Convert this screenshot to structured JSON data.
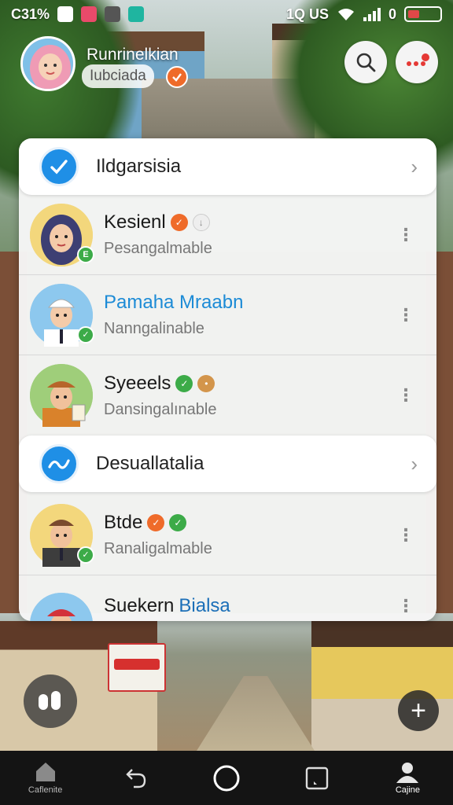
{
  "status_bar": {
    "left_text": "C31%",
    "right_text": "1Q US",
    "battery_text": "0"
  },
  "header": {
    "title": "Runrinelkian",
    "subtitle": "Iubciada"
  },
  "sections": [
    {
      "label": "Ildgarsisia"
    },
    {
      "label": "Desuallatalia"
    }
  ],
  "contacts": [
    {
      "name": "Kesienl",
      "subtitle": "Pesangalmable",
      "check_text": "E"
    },
    {
      "name": "Pamaha Mraabn",
      "subtitle": "Nanngalinable",
      "check_text": "✓"
    },
    {
      "name": "Syeeels",
      "subtitle": "Dansingalınable"
    },
    {
      "name": "Btde",
      "subtitle": "Ranaligalmable",
      "check_text": "✓"
    },
    {
      "name": "Suekern",
      "name_highlight": "Bialsa"
    }
  ],
  "bottom_nav": [
    {
      "label": "Caflenite",
      "icon": "home-icon"
    },
    {
      "label": "",
      "icon": "back-icon"
    },
    {
      "label": "",
      "icon": "home-circle-icon"
    },
    {
      "label": "",
      "icon": "recents-icon"
    },
    {
      "label": "Cajine",
      "icon": "profile-icon"
    }
  ],
  "colors": {
    "accent_blue": "#1f8fe6",
    "verified_green": "#3cab48",
    "badge_orange": "#ef6b2a",
    "nav_bg": "#141414"
  }
}
